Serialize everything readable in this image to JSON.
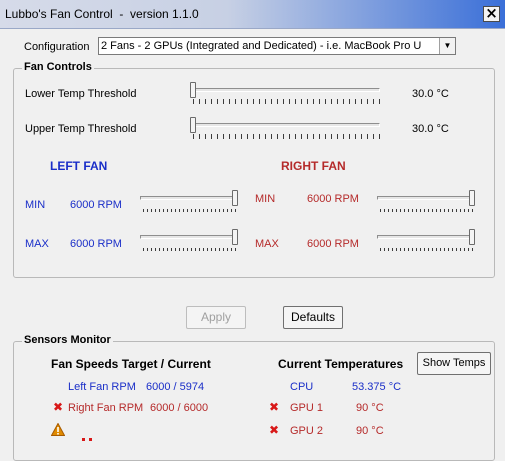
{
  "window": {
    "title": "Lubbo's Fan Control  -  version 1.1.0"
  },
  "configuration": {
    "label": "Configuration",
    "selected": "2 Fans - 2 GPUs (Integrated and Dedicated) - i.e. MacBook Pro U"
  },
  "fan_controls": {
    "title": "Fan Controls",
    "lower_threshold": {
      "label": "Lower Temp Threshold",
      "value": "30.0 °C",
      "level": 0.0
    },
    "upper_threshold": {
      "label": "Upper Temp Threshold",
      "value": "30.0 °C",
      "level": 0.0
    },
    "left_fan": {
      "heading": "LEFT FAN",
      "min_label": "MIN",
      "min_value": "6000 RPM",
      "min_level": 1.0,
      "max_label": "MAX",
      "max_value": "6000 RPM",
      "max_level": 1.0
    },
    "right_fan": {
      "heading": "RIGHT FAN",
      "min_label": "MIN",
      "min_value": "6000 RPM",
      "min_level": 1.0,
      "max_label": "MAX",
      "max_value": "6000 RPM",
      "max_level": 1.0
    }
  },
  "buttons": {
    "apply": "Apply",
    "defaults": "Defaults",
    "show_temps": "Show Temps"
  },
  "sensors": {
    "title": "Sensors Monitor",
    "fan_header": "Fan Speeds Target / Current",
    "temp_header": "Current Temperatures",
    "fans": [
      {
        "label": "Left  Fan RPM",
        "value": "6000 / 5974",
        "status_icon": ""
      },
      {
        "label": "Right Fan RPM",
        "value": "6000 / 6000",
        "status_icon": "error-x-icon"
      }
    ],
    "warning_icon": "warning-triangle-icon",
    "temps": [
      {
        "label": "CPU",
        "value": "53.375 °C",
        "status_icon": ""
      },
      {
        "label": "GPU 1",
        "value": "90 °C",
        "status_icon": "error-x-icon"
      },
      {
        "label": "GPU 2",
        "value": "90 °C",
        "status_icon": "error-x-icon"
      }
    ]
  },
  "colors": {
    "left_fan": "#1a2ec8",
    "right_fan": "#b52a2a",
    "error": "#d81818",
    "warning": "#e08a00"
  }
}
